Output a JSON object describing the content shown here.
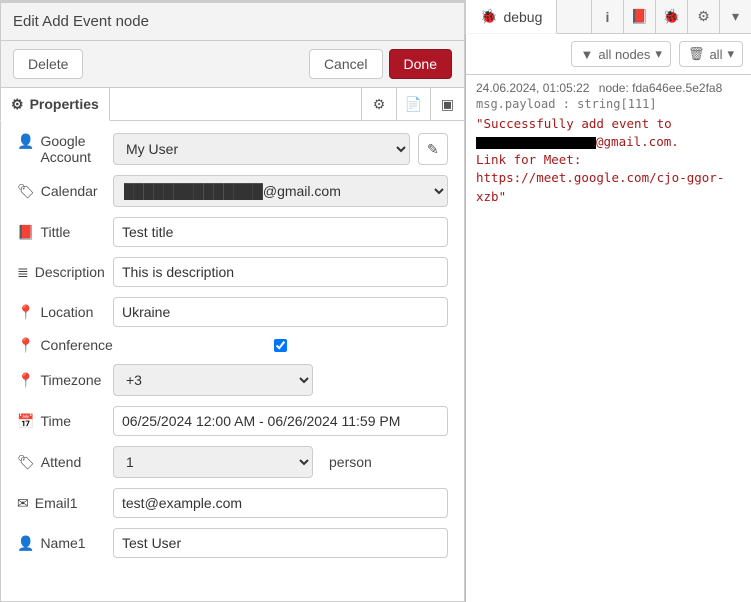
{
  "dialog": {
    "title": "Edit Add Event node",
    "delete_label": "Delete",
    "cancel_label": "Cancel",
    "done_label": "Done"
  },
  "tabs": {
    "properties_label": "Properties"
  },
  "form": {
    "google_account": {
      "label": "Google Account",
      "value": "My User"
    },
    "calendar": {
      "label": "Calendar",
      "value_suffix": "@gmail.com"
    },
    "title": {
      "label": "Tittle",
      "value": "Test title"
    },
    "description": {
      "label": "Description",
      "value": "This is description"
    },
    "location": {
      "label": "Location",
      "value": "Ukraine"
    },
    "conference": {
      "label": "Conference",
      "checked": true
    },
    "timezone": {
      "label": "Timezone",
      "value": "+3"
    },
    "time": {
      "label": "Time",
      "value": "06/25/2024 12:00 AM - 06/26/2024 11:59 PM"
    },
    "attend": {
      "label": "Attend",
      "value": "1",
      "suffix": "person"
    },
    "email1": {
      "label": "Email1",
      "value": "test@example.com"
    },
    "name1": {
      "label": "Name1",
      "value": "Test User"
    }
  },
  "right": {
    "tab_label": "debug",
    "filter_label": "all nodes",
    "trash_label": "all"
  },
  "debug_entry": {
    "timestamp": "24.06.2024, 01:05:22",
    "node_prefix": "node:",
    "node_id": "fda646ee.5e2fa8",
    "path": "msg.payload : string[111]",
    "msg_line1": "\"Successfully add event to",
    "msg_email_suffix": "@gmail.com.",
    "msg_line2": "Link for Meet:",
    "msg_line3": "https://meet.google.com/cjo-ggor-xzb\""
  },
  "icons": {
    "gear": "⚙",
    "bug": "🐞",
    "user": "👤",
    "book": "📕",
    "doc": "📄",
    "box": "▣",
    "pencil": "✎",
    "tag": "🏷",
    "list": "≣",
    "pin": "📍",
    "calendar": "📅",
    "envelope": "✉",
    "funnel": "⏷",
    "trash": "🗑",
    "chevron": "▾",
    "info": "i"
  }
}
